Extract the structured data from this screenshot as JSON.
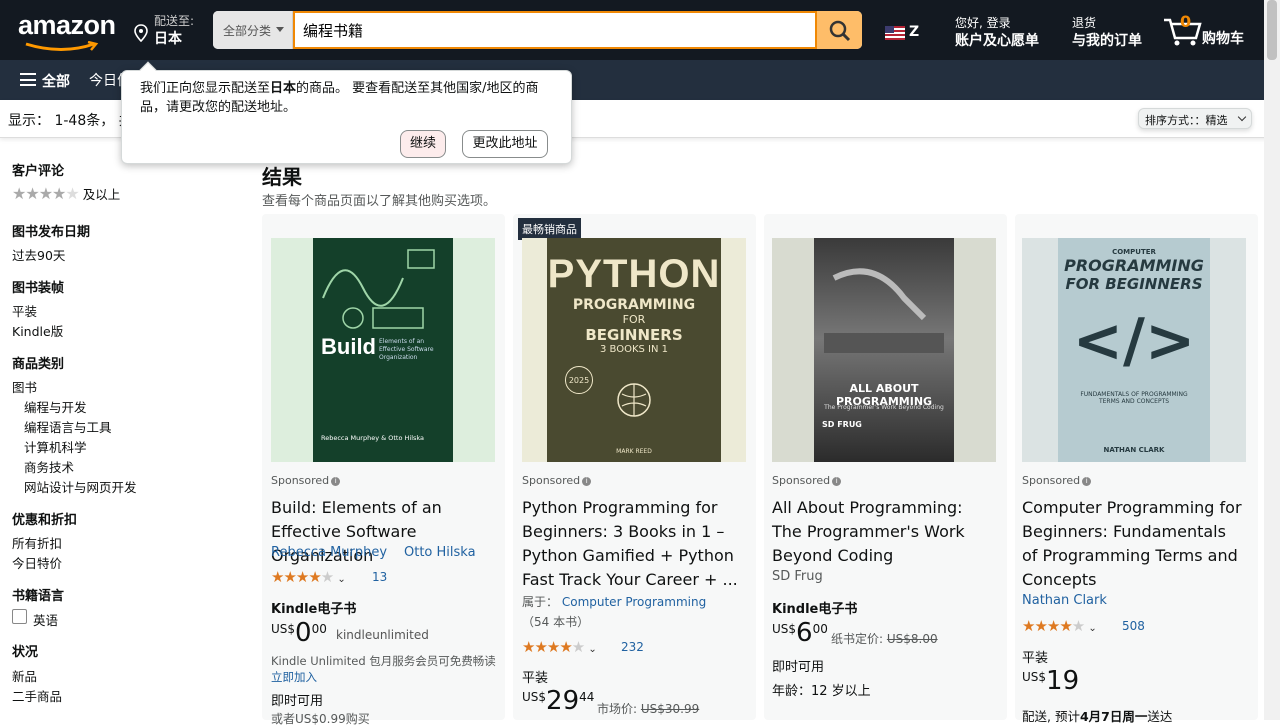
{
  "header": {
    "logo_text": "amazon",
    "deliver_to_label": "配送至:",
    "deliver_to_country": "日本",
    "search": {
      "category": "全部分类",
      "query": "编程书籍"
    },
    "language_code": "Z",
    "account_line1": "您好, 登录",
    "account_line2": "账户及心愿单",
    "orders_line1": "退货",
    "orders_line2": "与我的订单",
    "cart_count": "0",
    "cart_label": "购物车",
    "all_menu": "全部",
    "deals": "今日优惠"
  },
  "popover": {
    "message_prefix": "我们正向您显示配送至",
    "message_bold": "日本",
    "message_suffix": "的商品。 要查看配送至其他国家/地区的商品，请更改您的配送地址。",
    "continue_button": "继续",
    "change_button": "更改此地址"
  },
  "results_bar": {
    "text": "显示： 1-48条， 共",
    "sort_label": "排序方式：：精选"
  },
  "sidebar": {
    "reviews_heading": "客户评论",
    "reviews_link": "及以上",
    "date_heading": "图书发布日期",
    "date_link": "过去90天",
    "binding_heading": "图书装帧",
    "binding_items": [
      "平装",
      "Kindle版"
    ],
    "category_heading": "商品类别",
    "category_top": "图书",
    "category_items": [
      "编程与开发",
      "编程语言与工具",
      "计算机科学",
      "商务技术",
      "网站设计与网页开发"
    ],
    "deals_heading": "优惠和折扣",
    "deals_items": [
      "所有折扣",
      "今日特价"
    ],
    "language_heading": "书籍语言",
    "language_item": "英语",
    "condition_heading": "状况",
    "condition_items": [
      "新品",
      "二手商品"
    ]
  },
  "main": {
    "heading": "结果",
    "subheading": "查看每个商品页面以了解其他购买选项。",
    "products": [
      {
        "sponsored": "Sponsored",
        "title": "Build: Elements of an Effective Software Organization",
        "authors": [
          "Rebecca Murphey",
          "Otto Hilska"
        ],
        "rating_count": "13",
        "format": "Kindle电子书",
        "price_symbol": "US$",
        "price_whole": "0",
        "price_fraction": "00",
        "ku_label": "kindleunlimited",
        "ku_text": "Kindle Unlimited 包月服务会员可免费畅读",
        "ku_join": "立即加入",
        "availability": "即时可用",
        "alt_buy": "或者US$0.99购买",
        "cover_title": "Build",
        "cover_sub": "Elements of an Effective Software Organization",
        "cover_authors": "Rebecca Murphey & Otto Hilska"
      },
      {
        "badge": "最畅销商品",
        "sponsored": "Sponsored",
        "title": "Python Programming for Beginners: 3 Books in 1 – Python Gamified + Python Fast Track Your Career + ...",
        "series_prefix": "属于：",
        "series": "Computer Programming",
        "series_count": "（54 本书）",
        "rating_count": "232",
        "format": "平装",
        "price_symbol": "US$",
        "price_whole": "29",
        "price_fraction": "44",
        "list_price_label": "市场价:",
        "list_price": "US$30.99",
        "cover_line1": "PYTHON",
        "cover_line2": "PROGRAMMING",
        "cover_line3": "FOR",
        "cover_line4": "BEGINNERS",
        "cover_line5": "3 BOOKS IN 1",
        "cover_author": "MARK REED",
        "cover_year": "2025"
      },
      {
        "sponsored": "Sponsored",
        "title": "All About Programming: The Programmer's Work Beyond Coding",
        "author_plain": "SD Frug",
        "format": "Kindle电子书",
        "price_symbol": "US$",
        "price_whole": "6",
        "price_fraction": "00",
        "list_price_label": "纸书定价:",
        "list_price": "US$8.00",
        "availability": "即时可用",
        "age": "年龄：12 岁以上",
        "cover_line1": "ALL ABOUT PROGRAMMING",
        "cover_line2": "The Programmer's Work Beyond Coding",
        "cover_author": "SD FRUG"
      },
      {
        "sponsored": "Sponsored",
        "title": "Computer Programming for Beginners: Fundamentals of Programming Terms and Concepts",
        "authors": [
          "Nathan Clark"
        ],
        "rating_count": "508",
        "format": "平装",
        "price_symbol": "US$",
        "price_whole": "19",
        "price_fraction": "",
        "delivery_prefix": "配送, 预计",
        "delivery_date": "4月7日周一",
        "delivery_suffix": "送达",
        "cover_line0": "COMPUTER",
        "cover_line1": "PROGRAMMING",
        "cover_line2": "FOR BEGINNERS",
        "cover_line3": "FUNDAMENTALS OF PROGRAMMING TERMS AND CONCEPTS",
        "cover_author": "NATHAN CLARK"
      }
    ]
  },
  "colors": {
    "header_bg": "#131921",
    "subnav_bg": "#232f3e",
    "search_button": "#febd69",
    "accent_orange": "#f08804",
    "link": "#2162a1",
    "star": "#de7921"
  }
}
